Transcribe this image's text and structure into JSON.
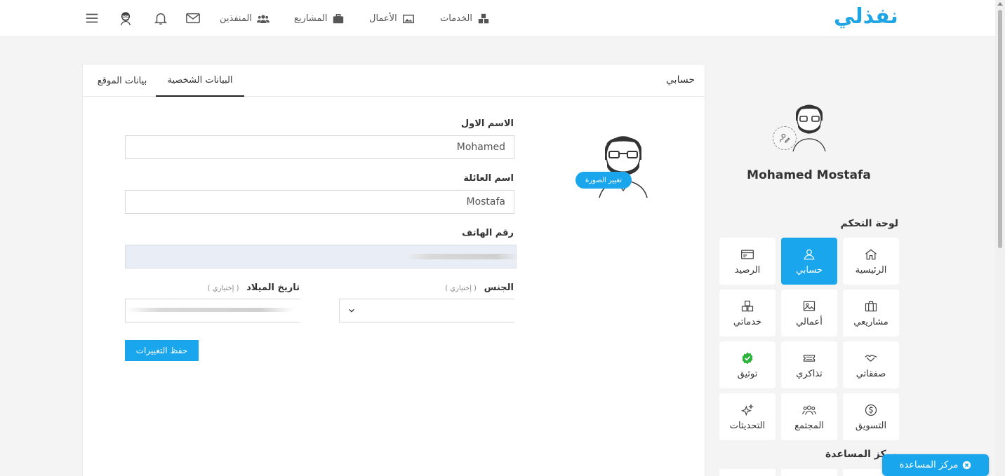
{
  "brand": {
    "logo_text": "نفذلي",
    "accent": "#1aa6ec"
  },
  "nav": {
    "services": "الخدمات",
    "works": "الأعمال",
    "projects": "المشاريع",
    "freelancers": "المنفذين"
  },
  "card": {
    "title": "حسابي",
    "tabs": [
      {
        "label": "البيانات الشخصية",
        "active": true
      },
      {
        "label": "بيانات الموقع",
        "active": false
      }
    ]
  },
  "form": {
    "first_name_label": "الاسم الاول",
    "first_name_value": "Mohamed",
    "last_name_label": "اسم العائلة",
    "last_name_value": "Mostafa",
    "phone_label": "رقم الهاتف",
    "gender_label": "الجنس",
    "optional": "( إختياري )",
    "birthdate_label": "تاريخ الميلاد",
    "save_label": "حفظ التغييرات",
    "change_photo_label": "تغيير الصورة"
  },
  "sidebar": {
    "user_name": "Mohamed Mostafa",
    "dashboard_heading": "لوحة التحكم",
    "help_heading": "مركز المساعدة",
    "tiles": [
      {
        "label": "الرئيسية",
        "icon": "home-icon",
        "active": false
      },
      {
        "label": "حسابي",
        "icon": "user-icon",
        "active": true
      },
      {
        "label": "الرصيد",
        "icon": "wallet-icon",
        "active": false
      },
      {
        "label": "مشاريعي",
        "icon": "briefcase-icon",
        "active": false
      },
      {
        "label": "أعمالي",
        "icon": "image-icon",
        "active": false
      },
      {
        "label": "خدماتي",
        "icon": "boxes-icon",
        "active": false
      },
      {
        "label": "صفقاتي",
        "icon": "handshake-icon",
        "active": false
      },
      {
        "label": "تذاكري",
        "icon": "ticket-icon",
        "active": false
      },
      {
        "label": "توثيق",
        "icon": "verified-icon",
        "active": false
      },
      {
        "label": "التسويق",
        "icon": "dollar-icon",
        "active": false
      },
      {
        "label": "المجتمع",
        "icon": "community-icon",
        "active": false
      },
      {
        "label": "التحديثات",
        "icon": "sparkle-icon",
        "active": false
      }
    ]
  },
  "help_button": {
    "label": "مركز المساعدة"
  }
}
